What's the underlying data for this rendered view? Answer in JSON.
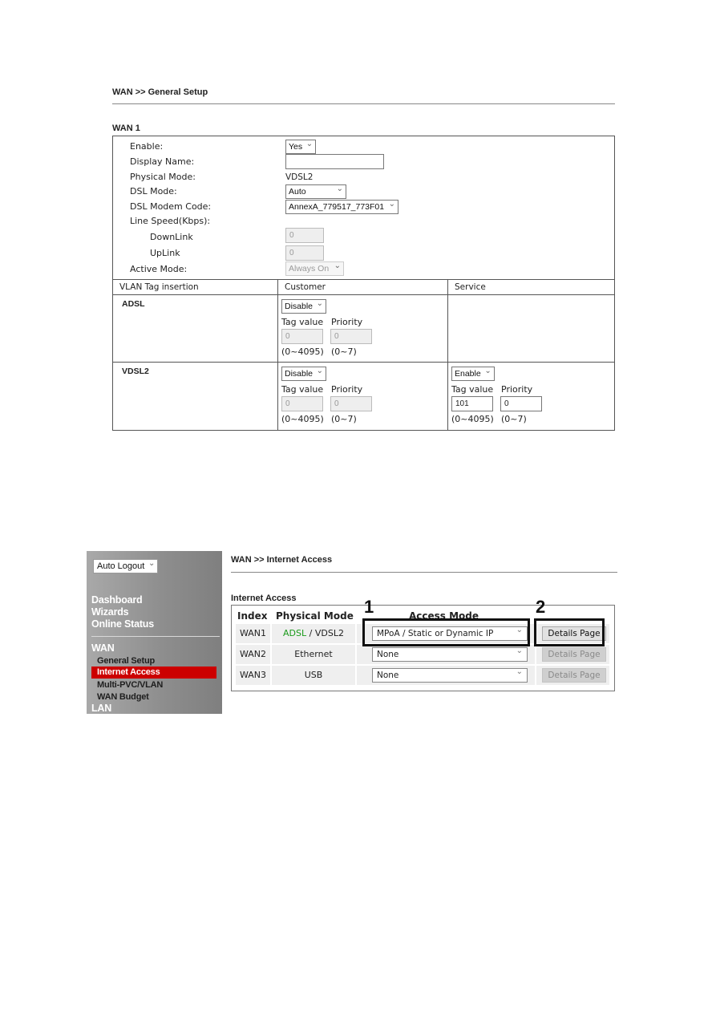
{
  "general_setup": {
    "breadcrumb": "WAN >> General Setup",
    "section_title": "WAN 1",
    "fields": {
      "enable": {
        "label": "Enable:",
        "value": "Yes"
      },
      "display_name": {
        "label": "Display Name:",
        "value": ""
      },
      "physical_mode": {
        "label": "Physical Mode:",
        "value": "VDSL2"
      },
      "dsl_mode": {
        "label": "DSL Mode:",
        "value": "Auto"
      },
      "dsl_modem_code": {
        "label": "DSL Modem Code:",
        "value": "AnnexA_779517_773F01"
      },
      "line_speed": {
        "label": "Line Speed(Kbps):"
      },
      "downlink": {
        "label": "DownLink",
        "value": "0"
      },
      "uplink": {
        "label": "UpLink",
        "value": "0"
      },
      "active_mode": {
        "label": "Active Mode:",
        "value": "Always On"
      }
    },
    "vlan": {
      "headers": [
        "VLAN Tag insertion",
        "Customer",
        "Service"
      ],
      "tag_value_label": "Tag value",
      "priority_label": "Priority",
      "tag_range": "(0~4095)",
      "priority_range": "(0~7)",
      "rows": [
        {
          "name": "ADSL",
          "customer": {
            "state": "Disable",
            "tag_value": "0",
            "priority": "0"
          }
        },
        {
          "name": "VDSL2",
          "customer": {
            "state": "Disable",
            "tag_value": "0",
            "priority": "0"
          },
          "service": {
            "state": "Enable",
            "tag_value": "101",
            "priority": "0"
          }
        }
      ]
    }
  },
  "sidebar": {
    "auto_logout": "Auto Logout",
    "items": [
      {
        "label": "Dashboard"
      },
      {
        "label": "Wizards"
      },
      {
        "label": "Online Status"
      }
    ],
    "wan_group": "WAN",
    "wan_items": [
      {
        "label": "General Setup"
      },
      {
        "label": "Internet Access",
        "active": true
      },
      {
        "label": "Multi-PVC/VLAN"
      },
      {
        "label": "WAN Budget"
      }
    ],
    "lan_group": "LAN",
    "active_color": "#cc0000"
  },
  "internet_access": {
    "breadcrumb": "WAN >> Internet Access",
    "section_title": "Internet Access",
    "headers": {
      "index": "Index",
      "physical_mode": "Physical Mode",
      "access_mode": "Access Mode"
    },
    "rows": [
      {
        "index": "WAN1",
        "mode_part1": "ADSL",
        "mode_sep": " / ",
        "mode_part2": "VDSL2",
        "access_mode": "MPoA / Static or Dynamic IP",
        "button": "Details Page",
        "button_enabled": true
      },
      {
        "index": "WAN2",
        "mode": "Ethernet",
        "access_mode": "None",
        "button": "Details Page",
        "button_enabled": false
      },
      {
        "index": "WAN3",
        "mode": "USB",
        "access_mode": "None",
        "button": "Details Page",
        "button_enabled": false
      }
    ],
    "callouts": [
      "1",
      "2"
    ]
  }
}
